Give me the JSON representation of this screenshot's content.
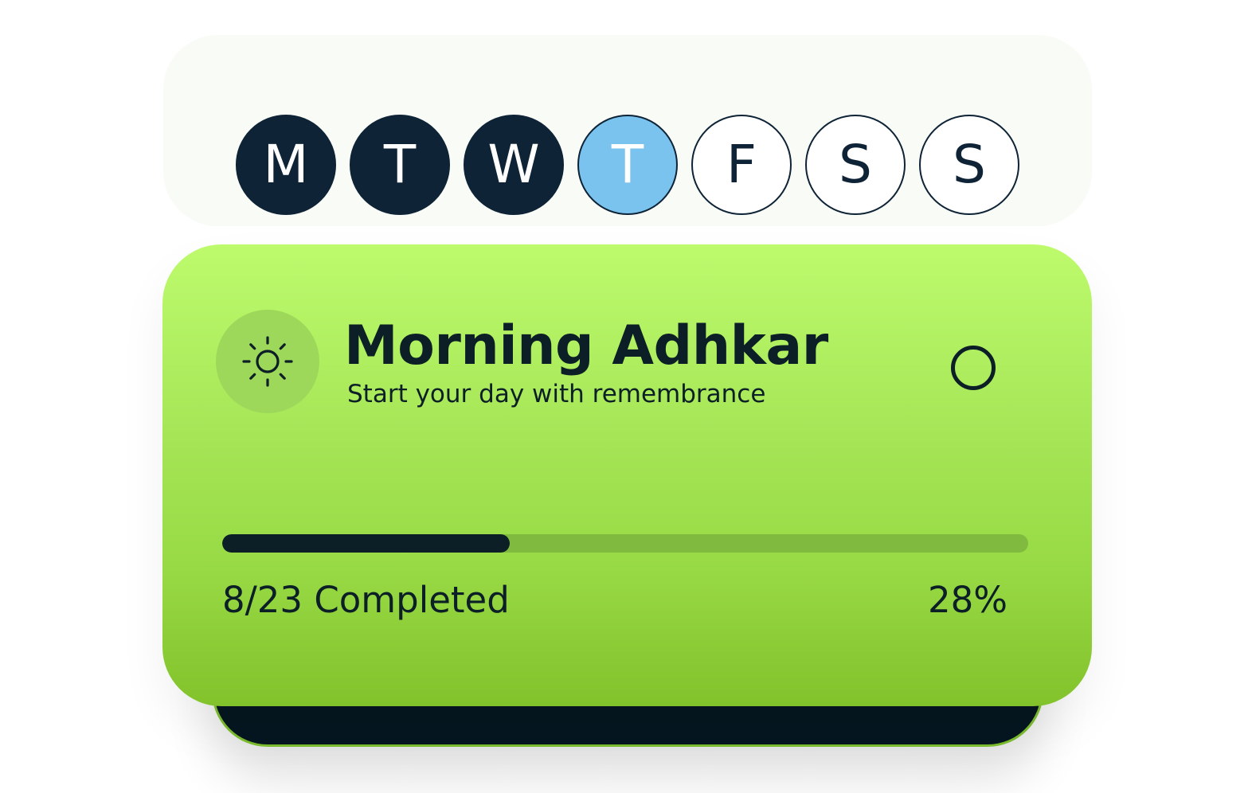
{
  "week": {
    "days": [
      {
        "label": "M",
        "state": "done"
      },
      {
        "label": "T",
        "state": "done"
      },
      {
        "label": "W",
        "state": "done"
      },
      {
        "label": "T",
        "state": "today"
      },
      {
        "label": "F",
        "state": "future"
      },
      {
        "label": "S",
        "state": "future"
      },
      {
        "label": "S",
        "state": "future"
      }
    ]
  },
  "card": {
    "icon": "sun-icon",
    "title": "Morning Adhkar",
    "subtitle": "Start your day with remembrance",
    "completed": 8,
    "total": 23,
    "progress_label": "8/23 Completed",
    "percent_label": "28%",
    "progress_fraction": 0.357
  },
  "colors": {
    "done": "#0e2336",
    "today": "#7ac3ef",
    "card_top": "#bdfb6d",
    "card_bottom": "#82c22b"
  }
}
